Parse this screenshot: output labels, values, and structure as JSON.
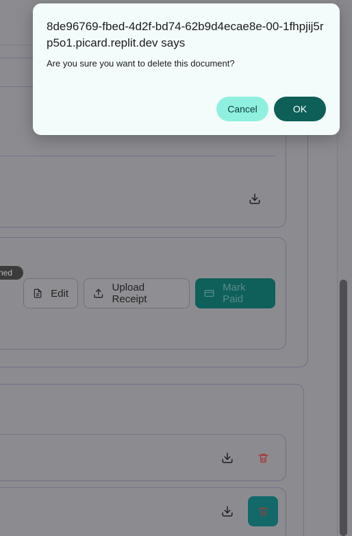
{
  "dialog": {
    "title": "8de96769-fbed-4d2f-bd74-62b9d4ecae8e-00-1fhpjij5rp5o1.picard.replit.dev says",
    "message": "Are you sure you want to delete this document?",
    "cancel_label": "Cancel",
    "ok_label": "OK"
  },
  "page": {
    "badge_label": "ned",
    "actions": {
      "edit_label": "Edit",
      "upload_receipt_label": "Upload Receipt",
      "mark_paid_label": "Mark Paid"
    }
  },
  "icons": {
    "download": "download-icon",
    "trash": "trash-icon",
    "document": "document-icon",
    "upload": "upload-icon",
    "card": "credit-card-icon"
  },
  "colors": {
    "accent": "#0e5f58",
    "cancel_bg": "#8ff0e0",
    "danger": "#c0392b"
  }
}
